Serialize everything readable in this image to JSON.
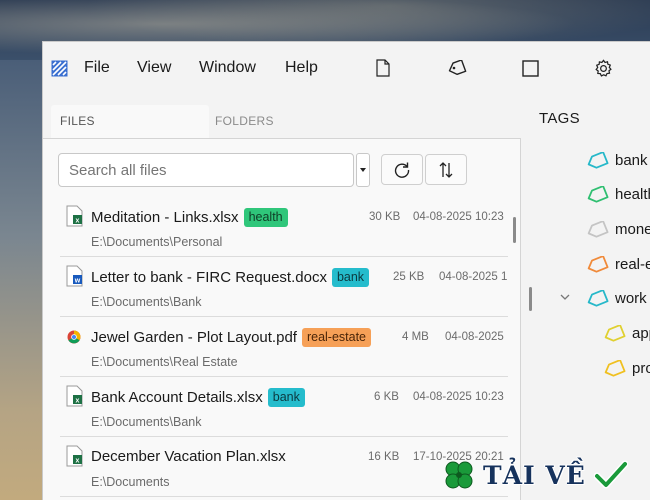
{
  "menu": {
    "file": "File",
    "view": "View",
    "window": "Window",
    "help": "Help"
  },
  "toolbar_icons": [
    "new-file-icon",
    "tag-icon",
    "square-icon",
    "settings-gear-icon"
  ],
  "tabs": {
    "files": "FILES",
    "folders": "FOLDERS",
    "active": "FILES"
  },
  "search": {
    "placeholder": "Search all files"
  },
  "files": [
    {
      "name": "Meditation - Links.xlsx",
      "type": "xlsx",
      "tag": "health",
      "size": "30 KB",
      "date": "04-08-2025 10:23",
      "path": "E:\\Documents\\Personal"
    },
    {
      "name": "Letter to bank - FIRC Request.docx",
      "type": "docx",
      "tag": "bank",
      "size": "25 KB",
      "date": "04-08-2025 1",
      "path": "E:\\Documents\\Bank"
    },
    {
      "name": "Jewel Garden - Plot Layout.pdf",
      "type": "pdf",
      "tag": "real-estate",
      "size": "4 MB",
      "date": "04-08-2025",
      "path": "E:\\Documents\\Real Estate"
    },
    {
      "name": "Bank Account Details.xlsx",
      "type": "xlsx",
      "tag": "bank",
      "size": "6 KB",
      "date": "04-08-2025 10:23",
      "path": "E:\\Documents\\Bank"
    },
    {
      "name": "December Vacation Plan.xlsx",
      "type": "xlsx",
      "tag": "",
      "size": "16 KB",
      "date": "17-10-2025 20:21",
      "path": "E:\\Documents"
    }
  ],
  "tags_title": "TAGS",
  "tags": [
    {
      "label": "bank",
      "color": "#26b8c9"
    },
    {
      "label": "health",
      "color": "#2fbf71"
    },
    {
      "label": "mone",
      "color": "#c4c4c4"
    },
    {
      "label": "real-e",
      "color": "#f08a3a"
    },
    {
      "label": "work",
      "color": "#26b8c9"
    },
    {
      "label": "app",
      "color": "#e0d030"
    },
    {
      "label": "pro",
      "color": "#f0c020"
    }
  ],
  "tag_colors": {
    "health": "#2fc67a",
    "bank": "#25bccc",
    "real-estate": "#f6a057"
  },
  "watermark": {
    "text": "TẢI VỀ"
  }
}
